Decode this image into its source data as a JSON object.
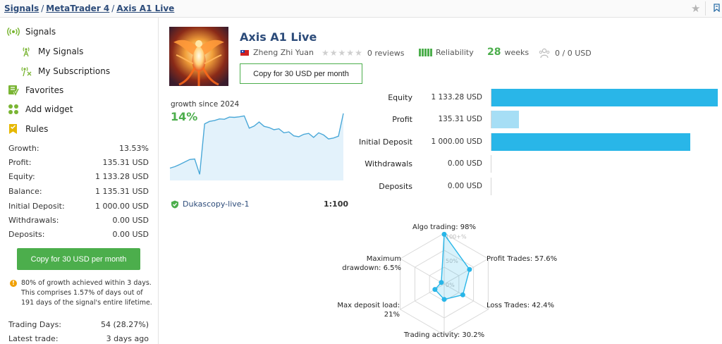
{
  "breadcrumb": {
    "signals": "Signals",
    "sep1": "/",
    "mt4": "MetaTrader 4",
    "sep2": "/",
    "current": "Axis A1 Live"
  },
  "sidebar": {
    "nav": [
      {
        "label": "Signals",
        "icon": "signal-icon"
      },
      {
        "label": "My Signals",
        "icon": "my-signals-icon"
      },
      {
        "label": "My Subscriptions",
        "icon": "subscriptions-icon"
      },
      {
        "label": "Favorites",
        "icon": "favorites-icon"
      },
      {
        "label": "Add widget",
        "icon": "widget-icon"
      },
      {
        "label": "Rules",
        "icon": "rules-icon"
      }
    ],
    "stats": [
      {
        "label": "Growth:",
        "value": "13.53%"
      },
      {
        "label": "Profit:",
        "value": "135.31 USD"
      },
      {
        "label": "Equity:",
        "value": "1 133.28 USD"
      },
      {
        "label": "Balance:",
        "value": "1 135.31 USD"
      },
      {
        "label": "Initial Deposit:",
        "value": "1 000.00 USD"
      },
      {
        "label": "Withdrawals:",
        "value": "0.00 USD"
      },
      {
        "label": "Deposits:",
        "value": "0.00 USD"
      }
    ],
    "copy_button": "Copy for 30 USD per month",
    "note": "80% of growth achieved within 3 days. This comprises 1.57% of days out of 191 days of the signal's entire lifetime.",
    "stats2": [
      {
        "label": "Trading Days:",
        "value": "54 (28.27%)"
      },
      {
        "label": "Latest trade:",
        "value": "3 days ago"
      }
    ]
  },
  "signal": {
    "title": "Axis A1 Live",
    "author": "Zheng Zhi Yuan",
    "reviews": "0 reviews",
    "rating_stars": 0,
    "reliability_label": "Reliability",
    "reliability_bars": 5,
    "weeks_number": "28",
    "weeks_label": "weeks",
    "subscribers": "0 / 0 USD",
    "copy_button": "Copy for 30 USD per month",
    "growth_label": "growth since 2024",
    "growth_value": "14%",
    "broker": "Dukascopy-live-1",
    "leverage": "1:100"
  },
  "financials": [
    {
      "label": "Equity",
      "value": "1 133.28 USD",
      "fraction": 1.0,
      "color": "#29b6e8"
    },
    {
      "label": "Profit",
      "value": "135.31 USD",
      "fraction": 0.12,
      "color": "#a6def5"
    },
    {
      "label": "Initial Deposit",
      "value": "1 000.00 USD",
      "fraction": 0.88,
      "color": "#29b6e8"
    },
    {
      "label": "Withdrawals",
      "value": "0.00 USD",
      "fraction": 0,
      "color": "#29b6e8"
    },
    {
      "label": "Deposits",
      "value": "0.00 USD",
      "fraction": 0,
      "color": "#29b6e8"
    }
  ],
  "colors": {
    "brand_blue": "#2d4c7a",
    "green": "#4cae4c",
    "chart_blue": "#29b6e8",
    "line_blue": "#4aa8d8"
  },
  "growth_series": [
    0,
    0.5,
    1.2,
    2.0,
    2.8,
    3.0,
    -2.0,
    14.4,
    15.2,
    15.5,
    16.0,
    15.9,
    16.6,
    16.5,
    16.7,
    17.0,
    13.0,
    13.7,
    15.0,
    13.6,
    13.2,
    12.5,
    12.8,
    11.5,
    11.8,
    10.5,
    10.2,
    11.0,
    11.3,
    10.0,
    11.5,
    10.8,
    9.5,
    9.8,
    10.4,
    17.8
  ],
  "radar_axes": [
    {
      "name": "Algo trading: 98%",
      "lines": [
        "Algo trading: 98%"
      ],
      "value": 98
    },
    {
      "name": "Profit Trades: 57.6%",
      "lines": [
        "Profit Trades: 57.6%"
      ],
      "value": 57.6
    },
    {
      "name": "Loss Trades: 42.4%",
      "lines": [
        "Loss Trades: 42.4%"
      ],
      "value": 42.4
    },
    {
      "name": "Trading activity: 30.2%",
      "lines": [
        "Trading activity: 30.2%"
      ],
      "value": 30.2
    },
    {
      "name": "Max deposit load: 21%",
      "lines": [
        "Max deposit load:",
        "21%"
      ],
      "value": 21
    },
    {
      "name": "Maximum drawdown: 6.5%",
      "lines": [
        "Maximum",
        "drawdown: 6.5%"
      ],
      "value": 6.5
    }
  ],
  "radar_ticks": [
    "100+%",
    "50%",
    "0%"
  ]
}
